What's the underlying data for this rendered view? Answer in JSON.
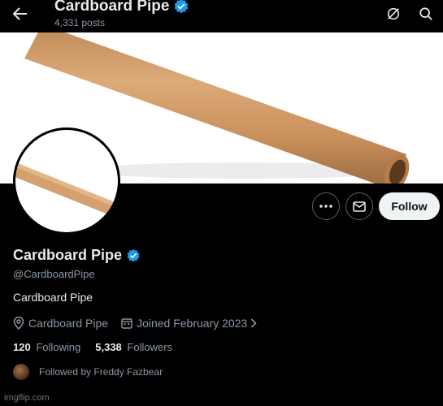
{
  "header": {
    "title": "Cardboard Pipe",
    "posts_count": "4,331 posts"
  },
  "profile": {
    "name": "Cardboard Pipe",
    "handle": "@CardboardPipe",
    "bio": "Cardboard Pipe",
    "location": "Cardboard Pipe",
    "joined": "Joined February 2023",
    "following_count": "120",
    "following_label": "Following",
    "followers_count": "5,338",
    "followers_label": "Followers",
    "followed_by": "Followed by Freddy Fazbear"
  },
  "actions": {
    "follow_label": "Follow"
  },
  "watermark": "imgflip.com",
  "colors": {
    "verified": "#1d9bf0",
    "background": "#000000",
    "follow_button": "#eff3f4"
  },
  "icons": [
    "back-arrow-icon",
    "verified-badge-icon",
    "grok-icon",
    "search-icon",
    "more-icon",
    "message-icon",
    "location-icon",
    "calendar-icon",
    "chevron-right-icon"
  ]
}
